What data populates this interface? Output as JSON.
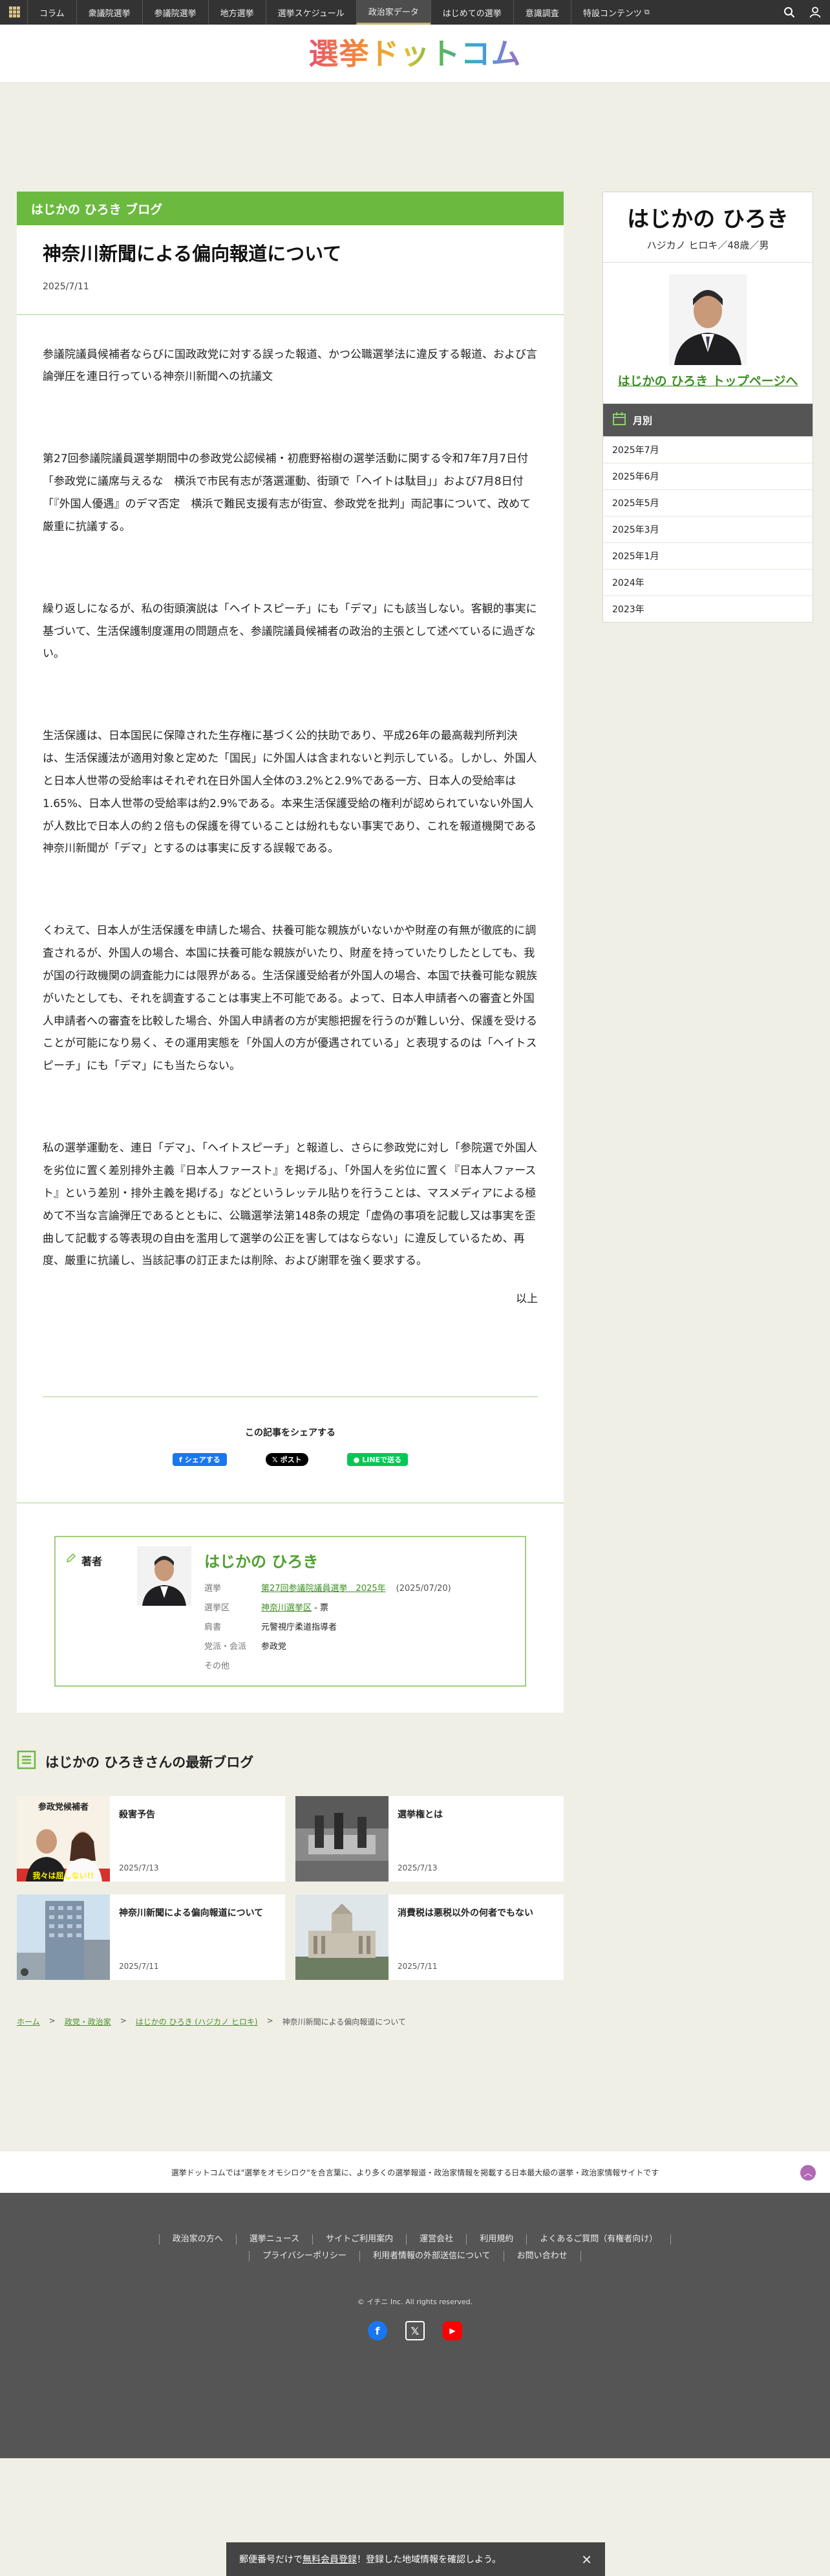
{
  "nav": {
    "items": [
      {
        "label": "コラム",
        "active": false
      },
      {
        "label": "衆議院選挙",
        "active": false
      },
      {
        "label": "参議院選挙",
        "active": false
      },
      {
        "label": "地方選挙",
        "active": false
      },
      {
        "label": "選挙スケジュール",
        "active": false
      },
      {
        "label": "政治家データ",
        "active": true
      },
      {
        "label": "はじめての選挙",
        "active": false
      },
      {
        "label": "意識調査",
        "active": false
      },
      {
        "label": "特設コンテンツ",
        "active": false
      }
    ]
  },
  "logo": {
    "text": "選挙ドットコム"
  },
  "blog": {
    "header": "はじかの ひろき ブログ",
    "title": "神奈川新聞による偏向報道について",
    "date": "2025/7/11",
    "paragraphs": [
      "参議院議員候補者ならびに国政政党に対する誤った報道、かつ公職選挙法に違反する報道、および言論弾圧を連日行っている神奈川新聞への抗議文",
      "第27回参議院議員選挙期間中の参政党公認候補・初鹿野裕樹の選挙活動に関する令和7年7月7日付「参政党に議席与えるな　横浜で市民有志が落選運動、街頭で「ヘイトは駄目」」および7月8日付「『外国人優遇』のデマ否定　横浜で難民支援有志が街宣、参政党を批判」両記事について、改めて厳重に抗議する。",
      "繰り返しになるが、私の街頭演説は「ヘイトスピーチ」にも「デマ」にも該当しない。客観的事実に基づいて、生活保護制度運用の問題点を、参議院議員候補者の政治的主張として述べているに過ぎない。",
      "生活保護は、日本国民に保障された生存権に基づく公的扶助であり、平成26年の最高裁判所判決は、生活保護法が適用対象と定めた「国民」に外国人は含まれないと判示している。しかし、外国人と日本人世帯の受給率はそれぞれ在日外国人全体の3.2%と2.9%である一方、日本人の受給率は1.65%、日本人世帯の受給率は約2.9%である。本来生活保護受給の権利が認められていない外国人が人数比で日本人の約２倍もの保護を得ていることは紛れもない事実であり、これを報道機関である神奈川新聞が「デマ」とするのは事実に反する誤報である。",
      "くわえて、日本人が生活保護を申請した場合、扶養可能な親族がいないかや財産の有無が徹底的に調査されるが、外国人の場合、本国に扶養可能な親族がいたり、財産を持っていたりしたとしても、我が国の行政機関の調査能力には限界がある。生活保護受給者が外国人の場合、本国で扶養可能な親族がいたとしても、それを調査することは事実上不可能である。よって、日本人申請者への審査と外国人申請者への審査を比較した場合、外国人申請者の方が実態把握を行うのが難しい分、保護を受けることが可能になり易く、その運用実態を「外国人の方が優遇されている」と表現するのは「ヘイトスピーチ」にも「デマ」にも当たらない。",
      "私の選挙運動を、連日「デマ」、「ヘイトスピーチ」と報道し、さらに参政党に対し「参院選で外国人を劣位に置く差別排外主義『日本人ファースト』を掲げる」、「外国人を劣位に置く『日本人ファースト』という差別・排外主義を掲げる」などというレッテル貼りを行うことは、マスメディアによる極めて不当な言論弾圧であるとともに、公職選挙法第148条の規定「虚偽の事項を記載し又は事実を歪曲して記載する等表現の自由を濫用して選挙の公正を害してはならない」に違反しているため、再度、厳重に抗議し、当該記事の訂正または削除、および謝罪を強く要求する。"
    ],
    "closing": "以上"
  },
  "share": {
    "title": "この記事をシェアする",
    "fb": "シェアする",
    "x": "ポスト",
    "line": "LINEで送る"
  },
  "author": {
    "label": "著者",
    "name": "はじかの ひろき",
    "rows": {
      "election_k": "選挙",
      "election_v": "第27回参議院議員選挙　2025年",
      "election_date": "(2025/07/20)",
      "district_k": "選挙区",
      "district_v": "神奈川選挙区",
      "district_suffix": " - 票",
      "title_k": "肩書",
      "title_v": "元警視庁柔道指導者",
      "party_k": "党派・会派",
      "party_v": "参政党",
      "other_k": "その他"
    }
  },
  "latest": {
    "title": "はじかの ひろきさんの最新ブログ",
    "posts": [
      {
        "title": "殺害予告",
        "date": "2025/7/13",
        "thumb_text_top": "参政党候補者",
        "thumb_text_bottom": "我々は屈しない!!"
      },
      {
        "title": "選挙権とは",
        "date": "2025/7/13"
      },
      {
        "title": "神奈川新聞による偏向報道について",
        "date": "2025/7/11"
      },
      {
        "title": "消費税は悪税以外の何者でもない",
        "date": "2025/7/11"
      }
    ]
  },
  "breadcrumb": {
    "home": "ホーム",
    "party": "政党・政治家",
    "person": "はじかの ひろき (ハジカノ ヒロキ)",
    "current": "神奈川新聞による偏向報道について",
    "sep": ">"
  },
  "profile": {
    "name": "はじかの ひろき",
    "kana": "ハジカノ ヒロキ／48歳／男",
    "link": "はじかの ひろき トップページへ"
  },
  "months": {
    "title": "月別",
    "items": [
      "2025年7月",
      "2025年6月",
      "2025年5月",
      "2025年3月",
      "2025年1月",
      "2024年",
      "2023年"
    ]
  },
  "footer": {
    "tagline": "選挙ドットコムでは\"選挙をオモシロク\"を合言葉に、より多くの選挙報道・政治家情報を掲載する日本最大級の選挙・政治家情報サイトです",
    "links": [
      "政治家の方へ",
      "選挙ニュース",
      "サイトご利用案内",
      "運営会社",
      "利用規約",
      "よくあるご質問（有権者向け）",
      "プライバシーポリシー",
      "利用者情報の外部送信について",
      "お問い合わせ"
    ],
    "copyright": "© イチニ Inc. All rights reserved."
  },
  "reg_bar": {
    "pre": "郵便番号だけで",
    "link": "無料会員登録",
    "post": "！登録した地域情報を確認しよう。"
  },
  "colors": {
    "accent_green": "#6bba3f",
    "link_green": "#3f8f25",
    "nav_bg": "#333333",
    "page_bg": "#f0efe6"
  }
}
